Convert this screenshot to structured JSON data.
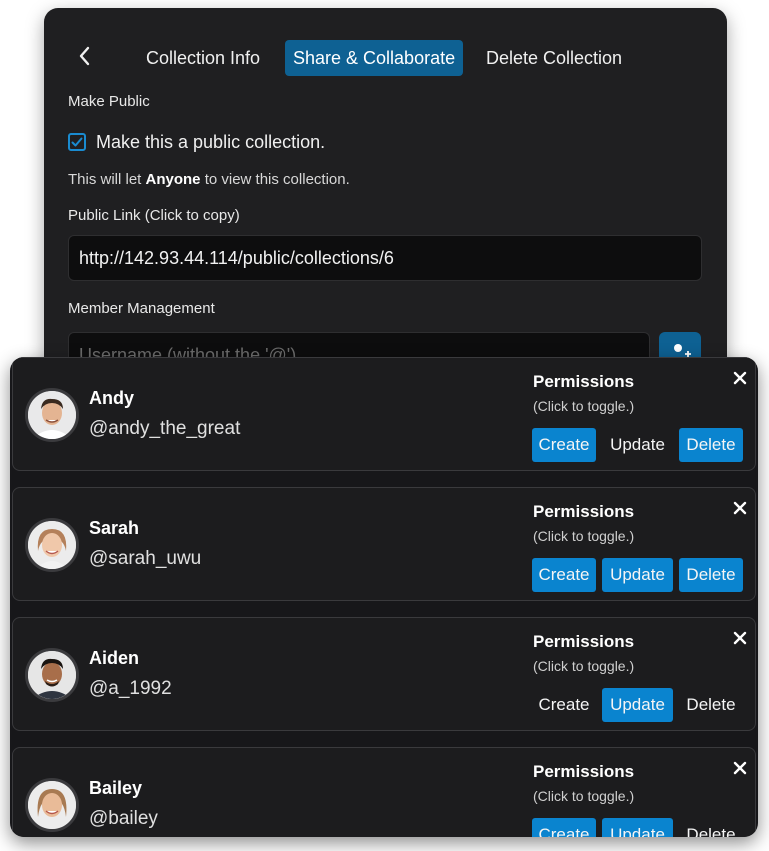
{
  "tabs": {
    "back_icon": "chevron-left-icon",
    "items": [
      "Collection Info",
      "Share & Collaborate",
      "Delete Collection"
    ],
    "active": "Share & Collaborate"
  },
  "public": {
    "section_label": "Make Public",
    "checkbox_label": "Make this a public collection.",
    "checked": true,
    "hint_prefix": "This will let ",
    "hint_bold": "Anyone",
    "hint_suffix": " to view this collection.",
    "link_label": "Public Link (Click to copy)",
    "link_value": "http://142.93.44.114/public/collections/6"
  },
  "members_section": {
    "label": "Member Management",
    "input_placeholder": "Username (without the '@')",
    "add_icon": "add-user-icon"
  },
  "permissions_title": "Permissions",
  "permissions_hint": "(Click to toggle.)",
  "permission_labels": {
    "create": "Create",
    "update": "Update",
    "delete": "Delete"
  },
  "members": [
    {
      "name": "Andy",
      "username": "@andy_the_great",
      "create": true,
      "update": false,
      "delete": true
    },
    {
      "name": "Sarah",
      "username": "@sarah_uwu",
      "create": true,
      "update": true,
      "delete": true
    },
    {
      "name": "Aiden",
      "username": "@a_1992",
      "create": false,
      "update": true,
      "delete": false
    },
    {
      "name": "Bailey",
      "username": "@bailey",
      "create": true,
      "update": true,
      "delete": false
    }
  ],
  "colors": {
    "accent": "#0a84cf",
    "active_tab": "#0e6193",
    "panel": "#1f1f21"
  }
}
